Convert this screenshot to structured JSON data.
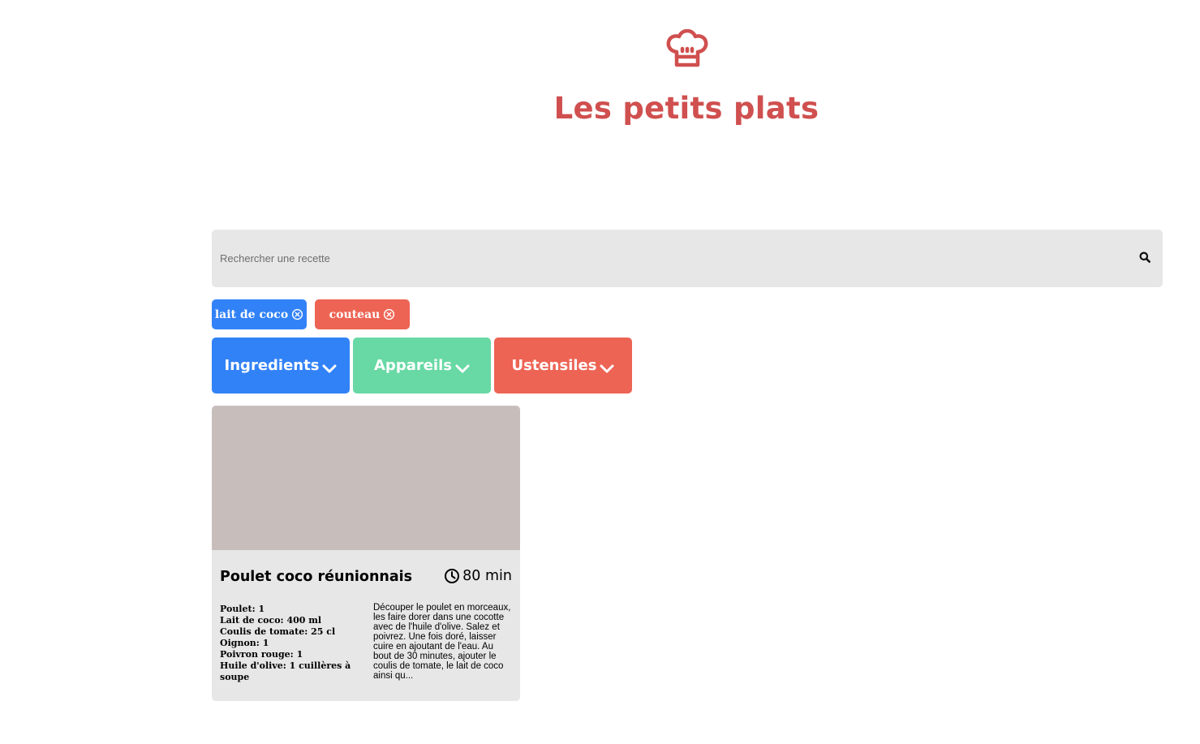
{
  "header": {
    "logo_icon": "chef-hat-icon",
    "title": "Les petits plats",
    "brand_color": "#d04f4f"
  },
  "search": {
    "placeholder": "Rechercher une recette",
    "value": "",
    "icon": "search-icon"
  },
  "tags": [
    {
      "label": "lait de coco",
      "type": "ingredient",
      "color": "#3282f7",
      "icon": "close-circle-icon"
    },
    {
      "label": "couteau",
      "type": "ustensile",
      "color": "#ed6454",
      "icon": "close-circle-icon"
    }
  ],
  "filters": [
    {
      "label": "Ingredients",
      "color": "#3282f7",
      "icon": "chevron-down-icon"
    },
    {
      "label": "Appareils",
      "color": "#68d9a4",
      "icon": "chevron-down-icon"
    },
    {
      "label": "Ustensiles",
      "color": "#ed6454",
      "icon": "chevron-down-icon"
    }
  ],
  "recipes": [
    {
      "title": "Poulet coco réunionnais",
      "time": "80 min",
      "time_icon": "clock-icon",
      "ingredients": [
        {
          "name": "Poulet",
          "qty": "1"
        },
        {
          "name": "Lait de coco",
          "qty": "400 ml"
        },
        {
          "name": "Coulis de tomate",
          "qty": "25 cl"
        },
        {
          "name": "Oignon",
          "qty": "1"
        },
        {
          "name": "Poivron rouge",
          "qty": "1"
        },
        {
          "name": "Huile d'olive",
          "qty": "1 cuillères à soupe"
        }
      ],
      "description": "Découper le poulet en morceaux, les faire dorer dans une cocotte avec de l'huile d'olive. Salez et poivrez. Une fois doré, laisser cuire en ajoutant de l'eau. Au bout de 30 minutes, ajouter le coulis de tomate, le lait de coco ainsi qu..."
    }
  ]
}
